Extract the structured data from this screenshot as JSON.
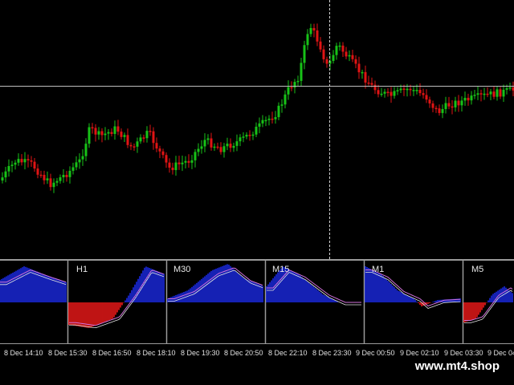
{
  "panels": {
    "labels": [
      "H1",
      "M30",
      "M15",
      "M1",
      "M5"
    ]
  },
  "time_axis": {
    "labels": [
      "8 Dec 14:10",
      "8 Dec 15:30",
      "8 Dec 16:50",
      "8 Dec 18:10",
      "8 Dec 19:30",
      "8 Dec 20:50",
      "8 Dec 22:10",
      "8 Dec 23:30",
      "9 Dec 00:50",
      "9 Dec 02:10",
      "9 Dec 03:30",
      "9 Dec 04"
    ]
  },
  "watermark": "www.mt4.shop",
  "colors": {
    "bull": "#17c217",
    "bear": "#e01414",
    "macd_pos": "#1c2cf0",
    "macd_neg": "#ff1a1a",
    "signal": "#d070d8",
    "grid": "#9a9a9a"
  }
}
